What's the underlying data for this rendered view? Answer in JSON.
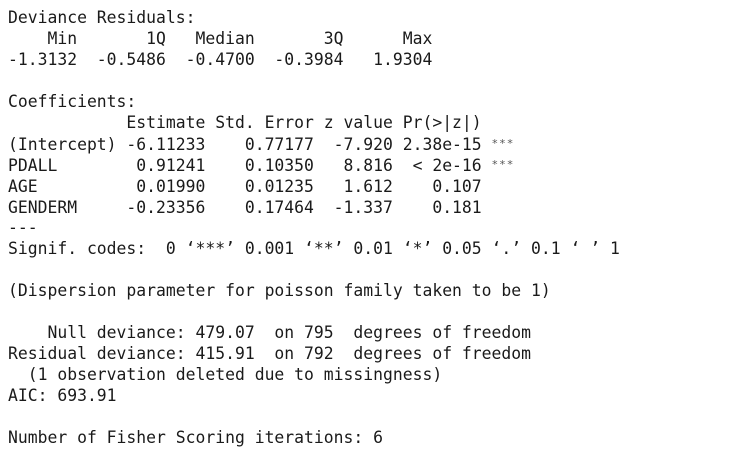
{
  "deviance_residuals": {
    "title": "Deviance Residuals:",
    "header": "    Min       1Q   Median       3Q      Max",
    "values": "-1.3132  -0.5486  -0.4700  -0.3984   1.9304"
  },
  "coefficients": {
    "title": "Coefficients:",
    "header": "            Estimate Std. Error z value Pr(>|z|)",
    "rows": [
      {
        "text": "(Intercept) -6.11233    0.77177  -7.920 2.38e-15 ",
        "stars": "***"
      },
      {
        "text": "PDALL        0.91241    0.10350   8.816  < 2e-16 ",
        "stars": "***"
      },
      {
        "text": "AGE          0.01990    0.01235   1.612    0.107",
        "stars": ""
      },
      {
        "text": "GENDERM     -0.23356    0.17464  -1.337    0.181",
        "stars": ""
      }
    ],
    "separator": "---",
    "signif_codes": "Signif. codes:  0 ‘***’ 0.001 ‘**’ 0.01 ‘*’ 0.05 ‘.’ 0.1 ‘ ’ 1"
  },
  "dispersion_note": "(Dispersion parameter for poisson family taken to be 1)",
  "deviance": {
    "null": "    Null deviance: 479.07  on 795  degrees of freedom",
    "residual": "Residual deviance: 415.91  on 792  degrees of freedom",
    "missing_note": "  (1 observation deleted due to missingness)"
  },
  "aic": "AIC: 693.91",
  "fisher_iterations": "Number of Fisher Scoring iterations: 6"
}
